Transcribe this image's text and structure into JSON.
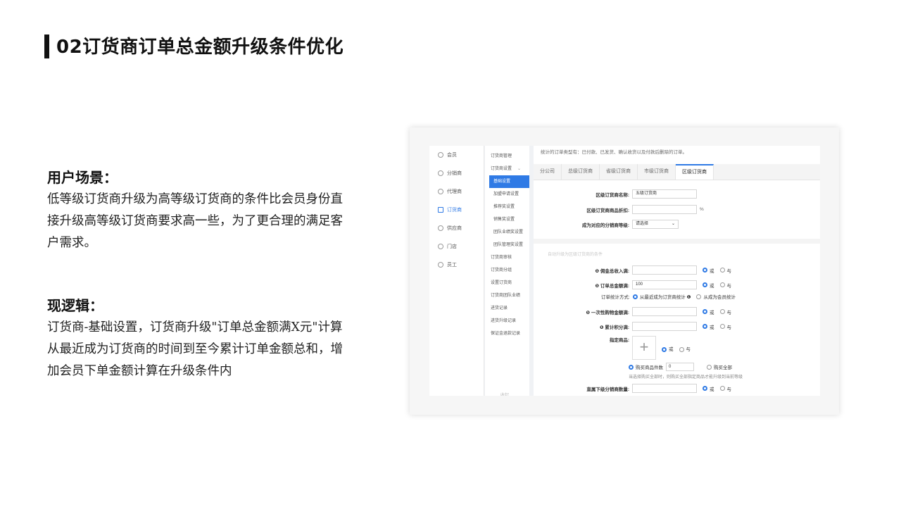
{
  "slide": {
    "title": "02订货商订单总金额升级条件优化",
    "scenario_heading": "用户场景：",
    "scenario_text": "低等级订货商升级为高等级订货商的条件比会员身份直接升级高等级订货商要求高一些，为了更合理的满足客户需求。",
    "logic_heading": "现逻辑：",
    "logic_text": "订货商-基础设置，订货商升级\"订单总金额满X元\"计算从最近成为订货商的时间到至今累计订单金额总和，增加会员下单金额计算在升级条件内"
  },
  "screenshot": {
    "nav1": [
      "会员",
      "分销商",
      "代理商",
      "订货商",
      "供应商",
      "门店",
      "员工"
    ],
    "nav1_active": "订货商",
    "nav2": {
      "manage": "订货商管理",
      "settings": "订货商设置",
      "basic": "基础设置",
      "join": "加盟申请设置",
      "recommend": "推荐奖设置",
      "sales": "销售奖设置",
      "team_perf": "团队业绩奖设置",
      "team_mgmt": "团队管理奖设置",
      "audit": "订货商审核",
      "group": "订货商分组",
      "set_dealer": "设置订货商",
      "team_perf2": "订货商团队业绩",
      "stock": "进货记录",
      "upgrade": "进货升级记录",
      "deposit": "保证金退款记录",
      "collapse": "收起"
    },
    "notice": "统计的订单类型有：已付款、已发货、确认收货以及付款后删除的订单。",
    "tabs": [
      "分公司",
      "总级订货商",
      "省级订货商",
      "市级订货商",
      "区级订货商"
    ],
    "active_tab": "区级订货商",
    "form": {
      "name_label": "区级订货商名称:",
      "name_value": "五级订货商",
      "discount_label": "区级订货商商品折扣:",
      "discount_unit": "%",
      "dist_level_label": "成为对应的分销商等级:",
      "dist_level_value": "请选择",
      "section_faint": "自动升级为区级订货商的条件",
      "commission_label": "❶ 佣金总收入满:",
      "order_total_label": "❶ 订单总金额满:",
      "order_total_value": "100",
      "stat_method_label": "订单统计方式:",
      "stat_opt1": "从最近成为订货商统计 ❶",
      "stat_opt2": "从成为会员统计",
      "one_time_label": "❶ 一次性购物金额满:",
      "points_label": "❶ 累计积分满:",
      "goods_label": "指定商品:",
      "plus": "+",
      "buy_count": "购买商品件数",
      "buy_count_value": "0",
      "buy_all": "购买全部",
      "buy_note": "当选择购买全部时，则购买全部指定商品才能升级到当前等级",
      "direct_label": "直属下级分销商数量:",
      "or": "或",
      "and": "与"
    }
  }
}
